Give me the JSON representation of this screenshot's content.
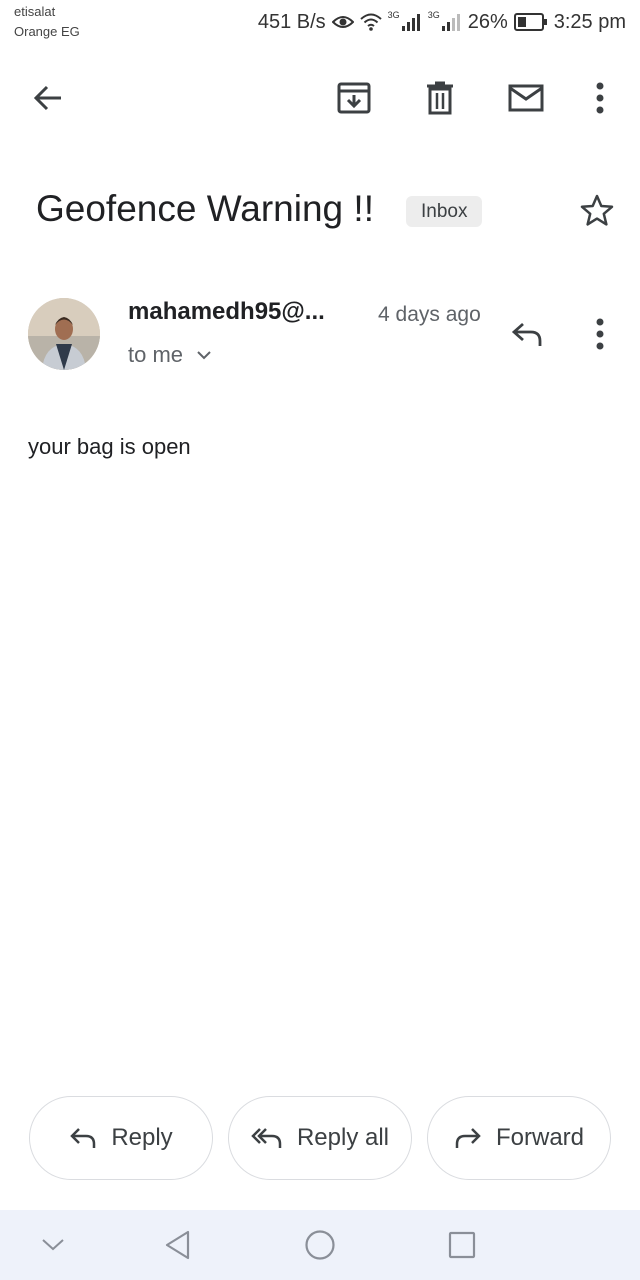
{
  "status_bar": {
    "carrier_1": "etisalat",
    "carrier_2": "Orange EG",
    "net_speed": "451 B/s",
    "sim1_type": "3G",
    "sim2_type": "3G",
    "battery": "26%",
    "time": "3:25 pm"
  },
  "toolbar": {
    "back_icon": "arrow-back-icon",
    "archive_icon": "archive-icon",
    "delete_icon": "trash-icon",
    "mark_unread_icon": "mail-icon",
    "more_icon": "more-vert-icon"
  },
  "email": {
    "subject": "Geofence Warning !!",
    "label": "Inbox",
    "sender": "mahamedh95@...",
    "time": "4 days ago",
    "recipient": "to me",
    "body": "your bag is open"
  },
  "actions": {
    "reply": "Reply",
    "reply_all": "Reply all",
    "forward": "Forward"
  },
  "colors": {
    "text": "#202124",
    "secondary": "#5f6368",
    "chip_bg": "#ededed",
    "navbar_bg": "#eef2fa"
  }
}
